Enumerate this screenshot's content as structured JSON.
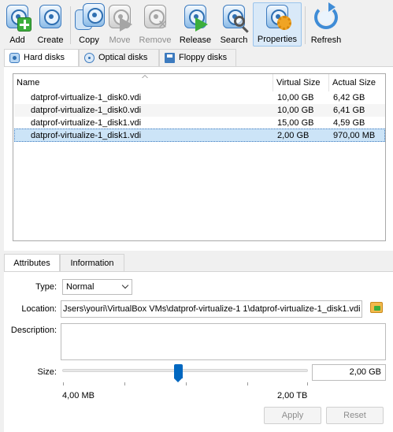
{
  "toolbar": {
    "add": "Add",
    "create": "Create",
    "copy": "Copy",
    "move": "Move",
    "remove": "Remove",
    "release": "Release",
    "search": "Search",
    "properties": "Properties",
    "refresh": "Refresh"
  },
  "media_tabs": [
    {
      "label": "Hard disks",
      "icon": "hard-disk-icon",
      "selected": true
    },
    {
      "label": "Optical disks",
      "icon": "optical-disk-icon",
      "selected": false
    },
    {
      "label": "Floppy disks",
      "icon": "floppy-disk-icon",
      "selected": false
    }
  ],
  "list": {
    "columns": [
      "Name",
      "Virtual Size",
      "Actual Size"
    ],
    "rows": [
      {
        "name": "datprof-virtualize-1_disk0.vdi",
        "virtual_size": "10,00 GB",
        "actual_size": "6,42 GB"
      },
      {
        "name": "datprof-virtualize-1_disk0.vdi",
        "virtual_size": "10,00 GB",
        "actual_size": "6,41 GB"
      },
      {
        "name": "datprof-virtualize-1_disk1.vdi",
        "virtual_size": "15,00 GB",
        "actual_size": "4,59 GB"
      },
      {
        "name": "datprof-virtualize-1_disk1.vdi",
        "virtual_size": "2,00 GB",
        "actual_size": "970,00 MB",
        "selected": true
      }
    ]
  },
  "details_tabs": [
    "Attributes",
    "Information"
  ],
  "attributes": {
    "type_label": "Type:",
    "type_value": "Normal",
    "location_label": "Location:",
    "location_value": "Jsers\\youri\\VirtualBox VMs\\datprof-virtualize-1 1\\datprof-virtualize-1_disk1.vdi",
    "description_label": "Description:",
    "description_value": "",
    "size_label": "Size:",
    "size_value": "2,00 GB",
    "slider_min": "4,00 MB",
    "slider_max": "2,00 TB"
  },
  "buttons": {
    "apply": "Apply",
    "reset": "Reset"
  }
}
